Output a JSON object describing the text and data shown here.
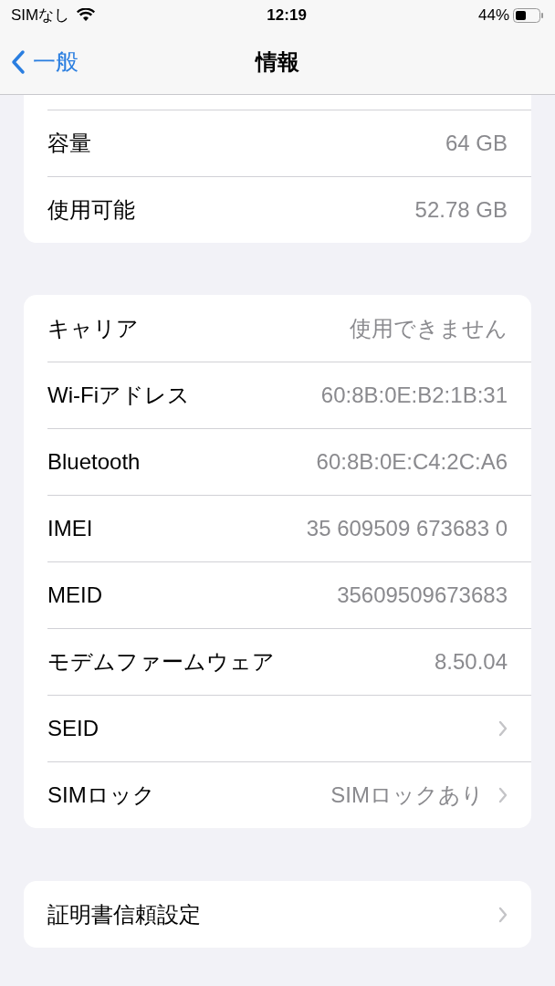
{
  "status_bar": {
    "carrier": "SIMなし",
    "time": "12:19",
    "battery": "44%"
  },
  "nav": {
    "back": "一般",
    "title": "情報"
  },
  "groups": [
    {
      "cut_top": true,
      "rows": [
        {
          "label": "容量",
          "value": "64 GB",
          "disclosure": false
        },
        {
          "label": "使用可能",
          "value": "52.78 GB",
          "disclosure": false
        }
      ]
    },
    {
      "cut_top": false,
      "rows": [
        {
          "label": "キャリア",
          "value": "使用できません",
          "disclosure": false
        },
        {
          "label": "Wi-Fiアドレス",
          "value": "60:8B:0E:B2:1B:31",
          "disclosure": false
        },
        {
          "label": "Bluetooth",
          "value": "60:8B:0E:C4:2C:A6",
          "disclosure": false
        },
        {
          "label": "IMEI",
          "value": "35 609509 673683 0",
          "disclosure": false
        },
        {
          "label": "MEID",
          "value": "35609509673683",
          "disclosure": false
        },
        {
          "label": "モデムファームウェア",
          "value": "8.50.04",
          "disclosure": false
        },
        {
          "label": "SEID",
          "disclosure": true
        },
        {
          "label": "SIMロック",
          "value": "SIMロックあり",
          "disclosure": true
        }
      ]
    },
    {
      "cut_top": false,
      "rows": [
        {
          "label": "証明書信頼設定",
          "disclosure": true
        }
      ]
    }
  ]
}
